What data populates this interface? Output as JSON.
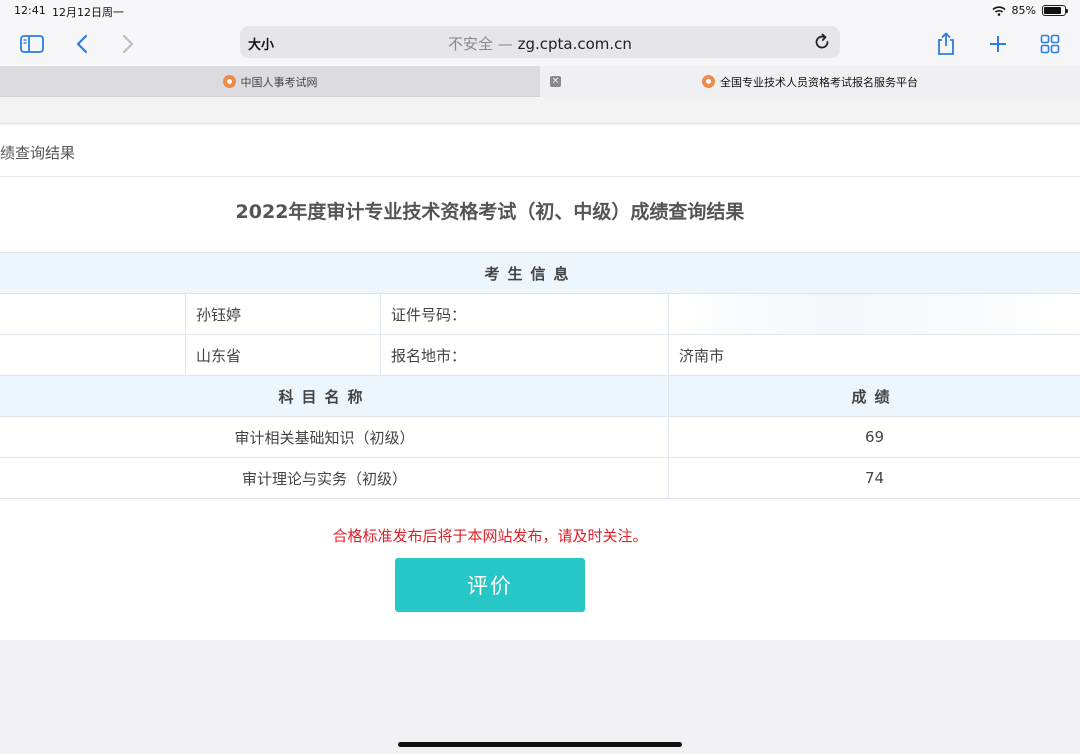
{
  "status_bar": {
    "time": "12:41",
    "date": "12月12日周一",
    "battery": "85%",
    "battery_level": 0.85
  },
  "toolbar": {
    "text_size": "大小",
    "not_secure": "不安全",
    "separator": " — ",
    "domain": "zg.cpta.com.cn",
    "icons": [
      "sidebar-icon",
      "back-icon",
      "forward-icon",
      "reload-icon",
      "share-icon",
      "new-tab-icon",
      "tabs-overview-icon"
    ]
  },
  "tabs": [
    {
      "title": "中国人事考试网",
      "active": false
    },
    {
      "title": "全国专业技术人员资格考试报名服务平台",
      "active": true
    }
  ],
  "panel": {
    "heading": "绩查询结果"
  },
  "page_title": "2022年度审计专业技术资格考试（初、中级）成绩查询结果",
  "exam_info": {
    "section_header": "考生信息",
    "name_value": "孙钰婷",
    "id_label": "证件号码：",
    "id_value": "",
    "province_value": "山东省",
    "city_label": "报名地市：",
    "city_value": "济南市"
  },
  "scores": {
    "subject_header": "科目名称",
    "score_header": "成绩",
    "rows": [
      {
        "subject": "审计相关基础知识（初级）",
        "score": "69"
      },
      {
        "subject": "审计理论与实务（初级）",
        "score": "74"
      }
    ]
  },
  "notice": "合格标准发布后将于本网站发布，请及时关注。",
  "evaluate_button": "评价",
  "colors": {
    "accent": "#2a7de1",
    "button": "#27c6c7",
    "notice": "#e0202a",
    "header_bg": "#eef6fd"
  }
}
